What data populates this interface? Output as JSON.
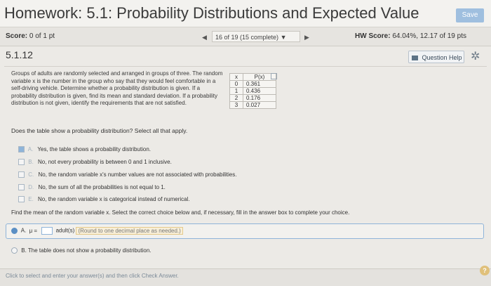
{
  "header": {
    "title": "Homework: 5.1: Probability Distributions and Expected Value",
    "save_label": "Save"
  },
  "score_bar": {
    "score_label": "Score:",
    "score_value": "0 of 1 pt",
    "prev_icon": "left-arrow",
    "question_selector": "16 of 19 (15 complete)",
    "selector_icon": "caret-down",
    "next_icon": "right-arrow",
    "hw_score_label": "HW Score:",
    "hw_score_value": "64.04%, 12.17 of 19 pts"
  },
  "question": {
    "id": "5.1.12",
    "help_label": "Question Help",
    "gear_icon": "gear",
    "text": "Groups of adults are randomly selected and arranged in groups of three. The random variable x is the number in the group who say that they would feel comfortable in a self-driving vehicle. Determine whether a probability distribution is given. If a probability distribution is given, find its mean and standard deviation. If a probability distribution is not given, identify the requirements that are not satisfied.",
    "table": {
      "headers": [
        "x",
        "P(x)"
      ],
      "rows": [
        {
          "x": "0",
          "p": "0.361"
        },
        {
          "x": "1",
          "p": "0.436"
        },
        {
          "x": "2",
          "p": "0.176"
        },
        {
          "x": "3",
          "p": "0.027"
        }
      ]
    }
  },
  "part1": {
    "prompt": "Does the table show a probability distribution? Select all that apply.",
    "options": [
      {
        "letter": "A.",
        "text": "Yes, the table shows a probability distribution.",
        "checked": true
      },
      {
        "letter": "B.",
        "text": "No, not every probability is between 0 and 1 inclusive.",
        "checked": false
      },
      {
        "letter": "C.",
        "text": "No, the random variable x's number values are not associated with probabilities.",
        "checked": false
      },
      {
        "letter": "D.",
        "text": "No, the sum of all the probabilities is not equal to 1.",
        "checked": false
      },
      {
        "letter": "E.",
        "text": "No, the random variable x is categorical instead of numerical.",
        "checked": false
      }
    ]
  },
  "part2": {
    "prompt": "Find the mean of the random variable x. Select the correct choice below and, if necessary, fill in the answer box to complete your choice.",
    "option_a_letter": "A.",
    "option_a_prefix": "μ =",
    "option_a_unit": "adult(s)",
    "option_a_hint": "(Round to one decimal place as needed.)",
    "option_b_letter": "B.",
    "option_b_text": "The table does not show a probability distribution."
  },
  "footer": {
    "instruction": "Click to select and enter your answer(s) and then click Check Answer.",
    "help_symbol": "?"
  }
}
